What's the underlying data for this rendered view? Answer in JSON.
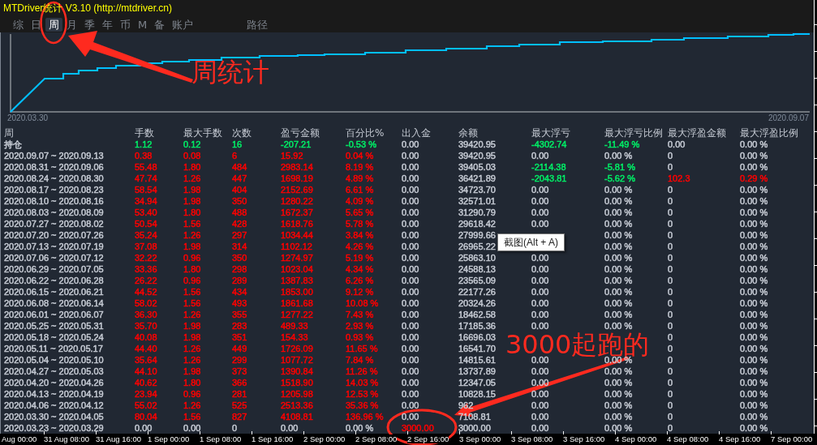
{
  "window": {
    "title": "MTDriver统计 V3.10 (http://mtdriver.cn)"
  },
  "tabs": [
    {
      "label": "综",
      "selected": false
    },
    {
      "label": "日",
      "selected": false
    },
    {
      "label": "周",
      "selected": true
    },
    {
      "label": "月",
      "selected": false
    },
    {
      "label": "季",
      "selected": false
    },
    {
      "label": "年",
      "selected": false
    },
    {
      "label": "币",
      "selected": false
    },
    {
      "label": "M",
      "selected": false
    },
    {
      "label": "备",
      "selected": false
    },
    {
      "label": "账户",
      "selected": false
    }
  ],
  "path_button": {
    "label": "路径"
  },
  "chart": {
    "start_label": "2020.03.30",
    "end_label": "2020.09.07"
  },
  "table": {
    "columns": [
      "周",
      "手数",
      "最大手数",
      "次数",
      "盈亏金额",
      "百分比%",
      "出入金",
      "余额",
      "最大浮亏",
      "最大浮亏比例",
      "最大浮盈金额",
      "最大浮盈比例"
    ],
    "rows": [
      {
        "cells": [
          {
            "text": "持仓",
            "color": "#c5cad3"
          },
          {
            "text": "1.12",
            "color": "#00ee66"
          },
          {
            "text": "0.12",
            "color": "#00ee66"
          },
          {
            "text": "16",
            "color": "#00ee66"
          },
          {
            "text": "-207.21",
            "color": "#00ee66"
          },
          {
            "text": "-0.53 %",
            "color": "#00ee66"
          },
          {
            "text": "0.00",
            "color": "#c5cad3"
          },
          {
            "text": "39420.95",
            "color": "#c5cad3"
          },
          {
            "text": "-4302.74",
            "color": "#00ee66"
          },
          {
            "text": "-11.49 %",
            "color": "#00ee66"
          },
          {
            "text": "0.00",
            "color": "#c5cad3"
          },
          {
            "text": "0.00 %",
            "color": "#c5cad3"
          }
        ]
      },
      {
        "cells": [
          {
            "text": "2020.09.07 ~ 2020.09.13",
            "color": "#c5cad3"
          },
          {
            "text": "0.38",
            "color": "#ff0000"
          },
          {
            "text": "0.08",
            "color": "#ff0000"
          },
          {
            "text": "6",
            "color": "#ff0000"
          },
          {
            "text": "15.92",
            "color": "#ff0000"
          },
          {
            "text": "0.04 %",
            "color": "#ff0000"
          },
          {
            "text": "0.00",
            "color": "#c5cad3"
          },
          {
            "text": "39420.95",
            "color": "#c5cad3"
          },
          {
            "text": "0.00",
            "color": "#c5cad3"
          },
          {
            "text": "0.00 %",
            "color": "#c5cad3"
          },
          {
            "text": "0",
            "color": "#c5cad3"
          },
          {
            "text": "0.00 %",
            "color": "#c5cad3"
          }
        ]
      },
      {
        "cells": [
          {
            "text": "2020.08.31 ~ 2020.09.06",
            "color": "#c5cad3"
          },
          {
            "text": "55.48",
            "color": "#ff0000"
          },
          {
            "text": "1.80",
            "color": "#ff0000"
          },
          {
            "text": "484",
            "color": "#ff0000"
          },
          {
            "text": "2983.14",
            "color": "#ff0000"
          },
          {
            "text": "8.19 %",
            "color": "#ff0000"
          },
          {
            "text": "0.00",
            "color": "#c5cad3"
          },
          {
            "text": "39405.03",
            "color": "#c5cad3"
          },
          {
            "text": "-2114.38",
            "color": "#00ee66"
          },
          {
            "text": "-5.81 %",
            "color": "#00ee66"
          },
          {
            "text": "0",
            "color": "#c5cad3"
          },
          {
            "text": "0.00 %",
            "color": "#c5cad3"
          }
        ]
      },
      {
        "cells": [
          {
            "text": "2020.08.24 ~ 2020.08.30",
            "color": "#c5cad3"
          },
          {
            "text": "47.74",
            "color": "#ff0000"
          },
          {
            "text": "1.26",
            "color": "#ff0000"
          },
          {
            "text": "447",
            "color": "#ff0000"
          },
          {
            "text": "1698.19",
            "color": "#ff0000"
          },
          {
            "text": "4.89 %",
            "color": "#ff0000"
          },
          {
            "text": "0.00",
            "color": "#c5cad3"
          },
          {
            "text": "36421.89",
            "color": "#c5cad3"
          },
          {
            "text": "-2043.81",
            "color": "#00ee66"
          },
          {
            "text": "-5.62 %",
            "color": "#00ee66"
          },
          {
            "text": "102.3",
            "color": "#ff0000"
          },
          {
            "text": "0.29 %",
            "color": "#ff0000"
          }
        ]
      },
      {
        "cells": [
          {
            "text": "2020.08.17 ~ 2020.08.23",
            "color": "#c5cad3"
          },
          {
            "text": "58.54",
            "color": "#ff0000"
          },
          {
            "text": "1.98",
            "color": "#ff0000"
          },
          {
            "text": "404",
            "color": "#ff0000"
          },
          {
            "text": "2152.69",
            "color": "#ff0000"
          },
          {
            "text": "6.61 %",
            "color": "#ff0000"
          },
          {
            "text": "0.00",
            "color": "#c5cad3"
          },
          {
            "text": "34723.70",
            "color": "#c5cad3"
          },
          {
            "text": "0.00",
            "color": "#c5cad3"
          },
          {
            "text": "0.00 %",
            "color": "#c5cad3"
          },
          {
            "text": "0",
            "color": "#c5cad3"
          },
          {
            "text": "0.00 %",
            "color": "#c5cad3"
          }
        ]
      },
      {
        "cells": [
          {
            "text": "2020.08.10 ~ 2020.08.16",
            "color": "#c5cad3"
          },
          {
            "text": "34.94",
            "color": "#ff0000"
          },
          {
            "text": "1.98",
            "color": "#ff0000"
          },
          {
            "text": "350",
            "color": "#ff0000"
          },
          {
            "text": "1280.22",
            "color": "#ff0000"
          },
          {
            "text": "4.09 %",
            "color": "#ff0000"
          },
          {
            "text": "0.00",
            "color": "#c5cad3"
          },
          {
            "text": "32571.01",
            "color": "#c5cad3"
          },
          {
            "text": "0.00",
            "color": "#c5cad3"
          },
          {
            "text": "0.00 %",
            "color": "#c5cad3"
          },
          {
            "text": "0",
            "color": "#c5cad3"
          },
          {
            "text": "0.00 %",
            "color": "#c5cad3"
          }
        ]
      },
      {
        "cells": [
          {
            "text": "2020.08.03 ~ 2020.08.09",
            "color": "#c5cad3"
          },
          {
            "text": "53.40",
            "color": "#ff0000"
          },
          {
            "text": "1.80",
            "color": "#ff0000"
          },
          {
            "text": "488",
            "color": "#ff0000"
          },
          {
            "text": "1672.37",
            "color": "#ff0000"
          },
          {
            "text": "5.65 %",
            "color": "#ff0000"
          },
          {
            "text": "0.00",
            "color": "#c5cad3"
          },
          {
            "text": "31290.79",
            "color": "#c5cad3"
          },
          {
            "text": "0.00",
            "color": "#c5cad3"
          },
          {
            "text": "0.00 %",
            "color": "#c5cad3"
          },
          {
            "text": "0",
            "color": "#c5cad3"
          },
          {
            "text": "0.00 %",
            "color": "#c5cad3"
          }
        ]
      },
      {
        "cells": [
          {
            "text": "2020.07.27 ~ 2020.08.02",
            "color": "#c5cad3"
          },
          {
            "text": "50.54",
            "color": "#ff0000"
          },
          {
            "text": "1.56",
            "color": "#ff0000"
          },
          {
            "text": "428",
            "color": "#ff0000"
          },
          {
            "text": "1618.76",
            "color": "#ff0000"
          },
          {
            "text": "5.78 %",
            "color": "#ff0000"
          },
          {
            "text": "0.00",
            "color": "#c5cad3"
          },
          {
            "text": "29618.42",
            "color": "#c5cad3"
          },
          {
            "text": "0.00",
            "color": "#c5cad3"
          },
          {
            "text": "0.00 %",
            "color": "#c5cad3"
          },
          {
            "text": "0",
            "color": "#c5cad3"
          },
          {
            "text": "0.00 %",
            "color": "#c5cad3"
          }
        ]
      },
      {
        "cells": [
          {
            "text": "2020.07.20 ~ 2020.07.26",
            "color": "#c5cad3"
          },
          {
            "text": "35.24",
            "color": "#ff0000"
          },
          {
            "text": "1.26",
            "color": "#ff0000"
          },
          {
            "text": "297",
            "color": "#ff0000"
          },
          {
            "text": "1034.44",
            "color": "#ff0000"
          },
          {
            "text": "3.84 %",
            "color": "#ff0000"
          },
          {
            "text": "0.00",
            "color": "#c5cad3"
          },
          {
            "text": "27999.66",
            "color": "#c5cad3"
          },
          null,
          {
            "text": "0.00 %",
            "color": "#c5cad3"
          },
          {
            "text": "0",
            "color": "#c5cad3"
          },
          {
            "text": "0.00 %",
            "color": "#c5cad3"
          }
        ]
      },
      {
        "cells": [
          {
            "text": "2020.07.13 ~ 2020.07.19",
            "color": "#c5cad3"
          },
          {
            "text": "37.08",
            "color": "#ff0000"
          },
          {
            "text": "1.98",
            "color": "#ff0000"
          },
          {
            "text": "314",
            "color": "#ff0000"
          },
          {
            "text": "1102.12",
            "color": "#ff0000"
          },
          {
            "text": "4.26 %",
            "color": "#ff0000"
          },
          {
            "text": "0.00",
            "color": "#c5cad3"
          },
          {
            "text": "26965.22",
            "color": "#c5cad3"
          },
          null,
          {
            "text": "0.00 %",
            "color": "#c5cad3"
          },
          {
            "text": "0",
            "color": "#c5cad3"
          },
          {
            "text": "0.00 %",
            "color": "#c5cad3"
          }
        ]
      },
      {
        "cells": [
          {
            "text": "2020.07.06 ~ 2020.07.12",
            "color": "#c5cad3"
          },
          {
            "text": "32.22",
            "color": "#ff0000"
          },
          {
            "text": "0.96",
            "color": "#ff0000"
          },
          {
            "text": "350",
            "color": "#ff0000"
          },
          {
            "text": "1274.97",
            "color": "#ff0000"
          },
          {
            "text": "5.19 %",
            "color": "#ff0000"
          },
          {
            "text": "0.00",
            "color": "#c5cad3"
          },
          {
            "text": "25863.10",
            "color": "#c5cad3"
          },
          {
            "text": "0.00",
            "color": "#c5cad3"
          },
          {
            "text": "0.00 %",
            "color": "#c5cad3"
          },
          {
            "text": "0",
            "color": "#c5cad3"
          },
          {
            "text": "0.00 %",
            "color": "#c5cad3"
          }
        ]
      },
      {
        "cells": [
          {
            "text": "2020.06.29 ~ 2020.07.05",
            "color": "#c5cad3"
          },
          {
            "text": "33.36",
            "color": "#ff0000"
          },
          {
            "text": "1.80",
            "color": "#ff0000"
          },
          {
            "text": "298",
            "color": "#ff0000"
          },
          {
            "text": "1023.04",
            "color": "#ff0000"
          },
          {
            "text": "4.34 %",
            "color": "#ff0000"
          },
          {
            "text": "0.00",
            "color": "#c5cad3"
          },
          {
            "text": "24588.13",
            "color": "#c5cad3"
          },
          {
            "text": "0.00",
            "color": "#c5cad3"
          },
          {
            "text": "0.00 %",
            "color": "#c5cad3"
          },
          {
            "text": "0",
            "color": "#c5cad3"
          },
          {
            "text": "0.00 %",
            "color": "#c5cad3"
          }
        ]
      },
      {
        "cells": [
          {
            "text": "2020.06.22 ~ 2020.06.28",
            "color": "#c5cad3"
          },
          {
            "text": "26.22",
            "color": "#ff0000"
          },
          {
            "text": "0.96",
            "color": "#ff0000"
          },
          {
            "text": "289",
            "color": "#ff0000"
          },
          {
            "text": "1387.83",
            "color": "#ff0000"
          },
          {
            "text": "6.26 %",
            "color": "#ff0000"
          },
          {
            "text": "0.00",
            "color": "#c5cad3"
          },
          {
            "text": "23565.09",
            "color": "#c5cad3"
          },
          {
            "text": "0.00",
            "color": "#c5cad3"
          },
          {
            "text": "0.00 %",
            "color": "#c5cad3"
          },
          {
            "text": "0",
            "color": "#c5cad3"
          },
          {
            "text": "0.00 %",
            "color": "#c5cad3"
          }
        ]
      },
      {
        "cells": [
          {
            "text": "2020.06.15 ~ 2020.06.21",
            "color": "#c5cad3"
          },
          {
            "text": "44.52",
            "color": "#ff0000"
          },
          {
            "text": "1.56",
            "color": "#ff0000"
          },
          {
            "text": "434",
            "color": "#ff0000"
          },
          {
            "text": "1853.00",
            "color": "#ff0000"
          },
          {
            "text": "9.12 %",
            "color": "#ff0000"
          },
          {
            "text": "0.00",
            "color": "#c5cad3"
          },
          {
            "text": "22177.26",
            "color": "#c5cad3"
          },
          {
            "text": "0.00",
            "color": "#c5cad3"
          },
          {
            "text": "0.00 %",
            "color": "#c5cad3"
          },
          {
            "text": "0",
            "color": "#c5cad3"
          },
          {
            "text": "0.00 %",
            "color": "#c5cad3"
          }
        ]
      },
      {
        "cells": [
          {
            "text": "2020.06.08 ~ 2020.06.14",
            "color": "#c5cad3"
          },
          {
            "text": "58.02",
            "color": "#ff0000"
          },
          {
            "text": "1.56",
            "color": "#ff0000"
          },
          {
            "text": "493",
            "color": "#ff0000"
          },
          {
            "text": "1861.68",
            "color": "#ff0000"
          },
          {
            "text": "10.08 %",
            "color": "#ff0000"
          },
          {
            "text": "0.00",
            "color": "#c5cad3"
          },
          {
            "text": "20324.26",
            "color": "#c5cad3"
          },
          {
            "text": "0.00",
            "color": "#c5cad3"
          },
          {
            "text": "0.00 %",
            "color": "#c5cad3"
          },
          {
            "text": "0",
            "color": "#c5cad3"
          },
          {
            "text": "0.00 %",
            "color": "#c5cad3"
          }
        ]
      },
      {
        "cells": [
          {
            "text": "2020.06.01 ~ 2020.06.07",
            "color": "#c5cad3"
          },
          {
            "text": "36.30",
            "color": "#ff0000"
          },
          {
            "text": "1.26",
            "color": "#ff0000"
          },
          {
            "text": "355",
            "color": "#ff0000"
          },
          {
            "text": "1277.22",
            "color": "#ff0000"
          },
          {
            "text": "7.43 %",
            "color": "#ff0000"
          },
          {
            "text": "0.00",
            "color": "#c5cad3"
          },
          {
            "text": "18462.58",
            "color": "#c5cad3"
          },
          {
            "text": "0.00",
            "color": "#c5cad3"
          },
          {
            "text": "0.00 %",
            "color": "#c5cad3"
          },
          {
            "text": "0",
            "color": "#c5cad3"
          },
          {
            "text": "0.00 %",
            "color": "#c5cad3"
          }
        ]
      },
      {
        "cells": [
          {
            "text": "2020.05.25 ~ 2020.05.31",
            "color": "#c5cad3"
          },
          {
            "text": "35.70",
            "color": "#ff0000"
          },
          {
            "text": "1.98",
            "color": "#ff0000"
          },
          {
            "text": "283",
            "color": "#ff0000"
          },
          {
            "text": "489.33",
            "color": "#ff0000"
          },
          {
            "text": "2.93 %",
            "color": "#ff0000"
          },
          {
            "text": "0.00",
            "color": "#c5cad3"
          },
          {
            "text": "17185.36",
            "color": "#c5cad3"
          },
          {
            "text": "0.00",
            "color": "#c5cad3"
          },
          {
            "text": "0.00 %",
            "color": "#c5cad3"
          },
          {
            "text": "0",
            "color": "#c5cad3"
          },
          {
            "text": "0.00 %",
            "color": "#c5cad3"
          }
        ]
      },
      {
        "cells": [
          {
            "text": "2020.05.18 ~ 2020.05.24",
            "color": "#c5cad3"
          },
          {
            "text": "40.08",
            "color": "#ff0000"
          },
          {
            "text": "1.98",
            "color": "#ff0000"
          },
          {
            "text": "351",
            "color": "#ff0000"
          },
          {
            "text": "154.33",
            "color": "#ff0000"
          },
          {
            "text": "0.93 %",
            "color": "#ff0000"
          },
          {
            "text": "0.00",
            "color": "#c5cad3"
          },
          {
            "text": "16696.03",
            "color": "#c5cad3"
          },
          null,
          null,
          {
            "text": "0",
            "color": "#c5cad3"
          },
          {
            "text": "0.00 %",
            "color": "#c5cad3"
          }
        ]
      },
      {
        "cells": [
          {
            "text": "2020.05.11 ~ 2020.05.17",
            "color": "#c5cad3"
          },
          {
            "text": "44.40",
            "color": "#ff0000"
          },
          {
            "text": "1.26",
            "color": "#ff0000"
          },
          {
            "text": "449",
            "color": "#ff0000"
          },
          {
            "text": "1726.09",
            "color": "#ff0000"
          },
          {
            "text": "11.65 %",
            "color": "#ff0000"
          },
          {
            "text": "0.00",
            "color": "#c5cad3"
          },
          {
            "text": "16541.70",
            "color": "#c5cad3"
          },
          null,
          null,
          {
            "text": "0",
            "color": "#c5cad3"
          },
          {
            "text": "0.00 %",
            "color": "#c5cad3"
          }
        ]
      },
      {
        "cells": [
          {
            "text": "2020.05.04 ~ 2020.05.10",
            "color": "#c5cad3"
          },
          {
            "text": "35.64",
            "color": "#ff0000"
          },
          {
            "text": "1.26",
            "color": "#ff0000"
          },
          {
            "text": "299",
            "color": "#ff0000"
          },
          {
            "text": "1077.72",
            "color": "#ff0000"
          },
          {
            "text": "7.84 %",
            "color": "#ff0000"
          },
          {
            "text": "0.00",
            "color": "#c5cad3"
          },
          {
            "text": "14815.61",
            "color": "#c5cad3"
          },
          {
            "text": "0.00",
            "color": "#c5cad3"
          },
          {
            "text": "0.00 %",
            "color": "#c5cad3"
          },
          {
            "text": "0",
            "color": "#c5cad3"
          },
          {
            "text": "0.00 %",
            "color": "#c5cad3"
          }
        ]
      },
      {
        "cells": [
          {
            "text": "2020.04.27 ~ 2020.05.03",
            "color": "#c5cad3"
          },
          {
            "text": "44.10",
            "color": "#ff0000"
          },
          {
            "text": "1.98",
            "color": "#ff0000"
          },
          {
            "text": "373",
            "color": "#ff0000"
          },
          {
            "text": "1390.84",
            "color": "#ff0000"
          },
          {
            "text": "11.26 %",
            "color": "#ff0000"
          },
          {
            "text": "0.00",
            "color": "#c5cad3"
          },
          {
            "text": "13737.89",
            "color": "#c5cad3"
          },
          {
            "text": "0.00",
            "color": "#c5cad3"
          },
          {
            "text": "0.00 %",
            "color": "#c5cad3"
          },
          {
            "text": "0",
            "color": "#c5cad3"
          },
          {
            "text": "0.00 %",
            "color": "#c5cad3"
          }
        ]
      },
      {
        "cells": [
          {
            "text": "2020.04.20 ~ 2020.04.26",
            "color": "#c5cad3"
          },
          {
            "text": "40.62",
            "color": "#ff0000"
          },
          {
            "text": "1.80",
            "color": "#ff0000"
          },
          {
            "text": "366",
            "color": "#ff0000"
          },
          {
            "text": "1518.90",
            "color": "#ff0000"
          },
          {
            "text": "14.03 %",
            "color": "#ff0000"
          },
          {
            "text": "0.00",
            "color": "#c5cad3"
          },
          {
            "text": "12347.05",
            "color": "#c5cad3"
          },
          {
            "text": "0.00",
            "color": "#c5cad3"
          },
          {
            "text": "0.00 %",
            "color": "#c5cad3"
          },
          {
            "text": "0",
            "color": "#c5cad3"
          },
          {
            "text": "0.00 %",
            "color": "#c5cad3"
          }
        ]
      },
      {
        "cells": [
          {
            "text": "2020.04.13 ~ 2020.04.19",
            "color": "#c5cad3"
          },
          {
            "text": "23.94",
            "color": "#ff0000"
          },
          {
            "text": "0.96",
            "color": "#ff0000"
          },
          {
            "text": "281",
            "color": "#ff0000"
          },
          {
            "text": "1205.98",
            "color": "#ff0000"
          },
          {
            "text": "12.53 %",
            "color": "#ff0000"
          },
          {
            "text": "0.00",
            "color": "#c5cad3"
          },
          {
            "text": "10828.15",
            "color": "#c5cad3"
          },
          {
            "text": "0.00",
            "color": "#c5cad3"
          },
          {
            "text": "0.00 %",
            "color": "#c5cad3"
          },
          {
            "text": "0",
            "color": "#c5cad3"
          },
          {
            "text": "0.00 %",
            "color": "#c5cad3"
          }
        ]
      },
      {
        "cells": [
          {
            "text": "2020.04.06 ~ 2020.04.12",
            "color": "#c5cad3"
          },
          {
            "text": "55.02",
            "color": "#ff0000"
          },
          {
            "text": "1.26",
            "color": "#ff0000"
          },
          {
            "text": "525",
            "color": "#ff0000"
          },
          {
            "text": "2513.36",
            "color": "#ff0000"
          },
          {
            "text": "35.36 %",
            "color": "#ff0000"
          },
          {
            "text": "0.00",
            "color": "#c5cad3"
          },
          {
            "text": "962",
            "color": "#c5cad3"
          },
          {
            "text": "0.00",
            "color": "#c5cad3"
          },
          {
            "text": "0.00 %",
            "color": "#c5cad3"
          },
          {
            "text": "0",
            "color": "#c5cad3"
          },
          {
            "text": "0.00 %",
            "color": "#c5cad3"
          }
        ]
      },
      {
        "cells": [
          {
            "text": "2020.03.30 ~ 2020.04.05",
            "color": "#c5cad3"
          },
          {
            "text": "80.04",
            "color": "#ff0000"
          },
          {
            "text": "1.56",
            "color": "#ff0000"
          },
          {
            "text": "827",
            "color": "#ff0000"
          },
          {
            "text": "4108.81",
            "color": "#ff0000"
          },
          {
            "text": "136.96 %",
            "color": "#ff0000"
          },
          {
            "text": "0.00",
            "color": "#c5cad3"
          },
          {
            "text": "7108.81",
            "color": "#c5cad3"
          },
          {
            "text": "0.00",
            "color": "#c5cad3"
          },
          {
            "text": "0.00 %",
            "color": "#c5cad3"
          },
          {
            "text": "0",
            "color": "#c5cad3"
          },
          {
            "text": "0.00 %",
            "color": "#c5cad3"
          }
        ]
      },
      {
        "cells": [
          {
            "text": "2020.03.23 ~ 2020.03.29",
            "color": "#c5cad3"
          },
          {
            "text": "0.00",
            "color": "#c5cad3"
          },
          {
            "text": "0.00",
            "color": "#c5cad3"
          },
          {
            "text": "0",
            "color": "#c5cad3"
          },
          {
            "text": "0.00",
            "color": "#c5cad3"
          },
          {
            "text": "0.00 %",
            "color": "#c5cad3"
          },
          {
            "text": "3000.00",
            "color": "#ff0000"
          },
          {
            "text": "3000.00",
            "color": "#c5cad3"
          },
          {
            "text": "0.00",
            "color": "#c5cad3"
          },
          {
            "text": "0.00 %",
            "color": "#c5cad3"
          },
          {
            "text": "0",
            "color": "#c5cad3"
          },
          {
            "text": "0.00 %",
            "color": "#c5cad3"
          }
        ]
      }
    ]
  },
  "time_axis": {
    "labels": [
      "Aug 00:00",
      "31 Aug 08:00",
      "31 Aug 16:00",
      "1 Sep 00:00",
      "1 Sep 08:00",
      "1 Sep 16:00",
      "2 Sep 00:00",
      "2 Sep 08:00",
      "2 Sep 16:00",
      "3 Sep 00:00",
      "3 Sep 08:00",
      "3 Sep 16:00",
      "4 Sep 00:00",
      "4 Sep 08:00",
      "4 Sep 16:00",
      "7 Sep 00:00"
    ]
  },
  "tooltip": {
    "text": "截图(Alt + A)"
  },
  "annotations": [
    {
      "text": "周统计"
    },
    {
      "text": "3000起跑的"
    }
  ]
}
